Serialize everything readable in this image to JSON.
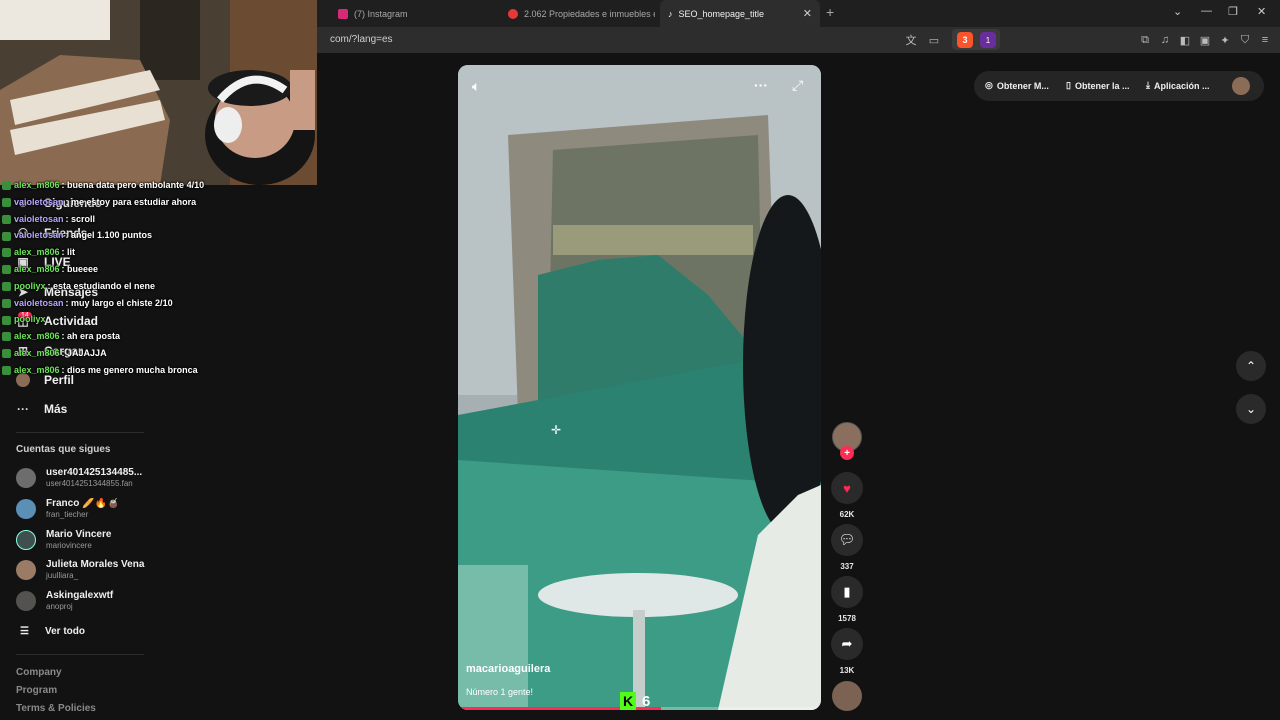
{
  "browser": {
    "tabs": [
      {
        "title": "(7) Instagram",
        "active": false,
        "color": "#d62976"
      },
      {
        "title": "2.062 Propiedades e inmuebles en B",
        "active": false,
        "color": "#e53935"
      },
      {
        "title": "SEO_homepage_title",
        "active": true,
        "color": "#ffffff"
      }
    ],
    "url": "com/?lang=es",
    "brave_badge": "3",
    "rewards_badge": "1"
  },
  "nav": {
    "items": [
      {
        "label": "Siguiendo",
        "icon": "following-icon"
      },
      {
        "label": "Friends",
        "icon": "friends-icon"
      },
      {
        "label": "LIVE",
        "icon": "live-icon"
      },
      {
        "label": "Mensajes",
        "icon": "messages-icon"
      },
      {
        "label": "Actividad",
        "icon": "activity-icon"
      },
      {
        "label": "Cargar",
        "icon": "upload-icon"
      },
      {
        "label": "Perfil",
        "icon": "profile-icon"
      },
      {
        "label": "Más",
        "icon": "more-icon"
      }
    ],
    "activity_badge": "14"
  },
  "following": {
    "title": "Cuentas que sigues",
    "accounts": [
      {
        "name": "user401425134485...",
        "handle": "user4014251344855.fan"
      },
      {
        "name": "Franco 🥖🔥🧉",
        "handle": "fran_tiecher"
      },
      {
        "name": "Mario Vincere",
        "handle": "mariovincere"
      },
      {
        "name": "Julieta Morales Vena",
        "handle": "juulliara_"
      },
      {
        "name": "Askingalexwtf",
        "handle": "anoproj"
      }
    ],
    "see_all": "Ver todo"
  },
  "footer": {
    "links": [
      "Company",
      "Program",
      "Terms & Policies"
    ]
  },
  "video": {
    "author": "macarioaguilera",
    "description": "Número 1 gente!",
    "progress": 0.56,
    "likes": "62K",
    "comments": "337",
    "saves": "1578",
    "shares": "13K"
  },
  "top_actions": {
    "coins": "Obtener M...",
    "app": "Obtener la ...",
    "desktop": "Aplicación ..."
  },
  "overlay": {
    "kick_count": "6",
    "chat": [
      {
        "user": "alex_m806",
        "msg": ": buena data pero embolante 4/10",
        "color": "#6ee35b"
      },
      {
        "user": "vaioletosan",
        "msg": ": me estoy para estudiar ahora",
        "color": "#b9a6ff"
      },
      {
        "user": "vaioletosan",
        "msg": ": scroll",
        "color": "#b9a6ff"
      },
      {
        "user": "vaioletosan",
        "msg": ": angel 1.100 puntos",
        "color": "#b9a6ff"
      },
      {
        "user": "alex_m806",
        "msg": ": lit",
        "color": "#6ee35b"
      },
      {
        "user": "alex_m806",
        "msg": ": bueeee",
        "color": "#6ee35b"
      },
      {
        "user": "pooliyx",
        "msg": ": esta estudiando el nene",
        "color": "#6ee35b"
      },
      {
        "user": "vaioletosan",
        "msg": ": muy largo el chiste 2/10",
        "color": "#b9a6ff"
      },
      {
        "user": "pooliyx",
        "msg": "",
        "color": "#6ee35b"
      },
      {
        "user": "alex_m806",
        "msg": ": ah era posta",
        "color": "#6ee35b"
      },
      {
        "user": "alex_m806",
        "msg": ": JAJAJJA",
        "color": "#6ee35b"
      },
      {
        "user": "alex_m806",
        "msg": ": dios me genero mucha bronca",
        "color": "#6ee35b"
      }
    ]
  },
  "colors": {
    "accent": "#fe2c55",
    "kick": "#53fc18"
  }
}
